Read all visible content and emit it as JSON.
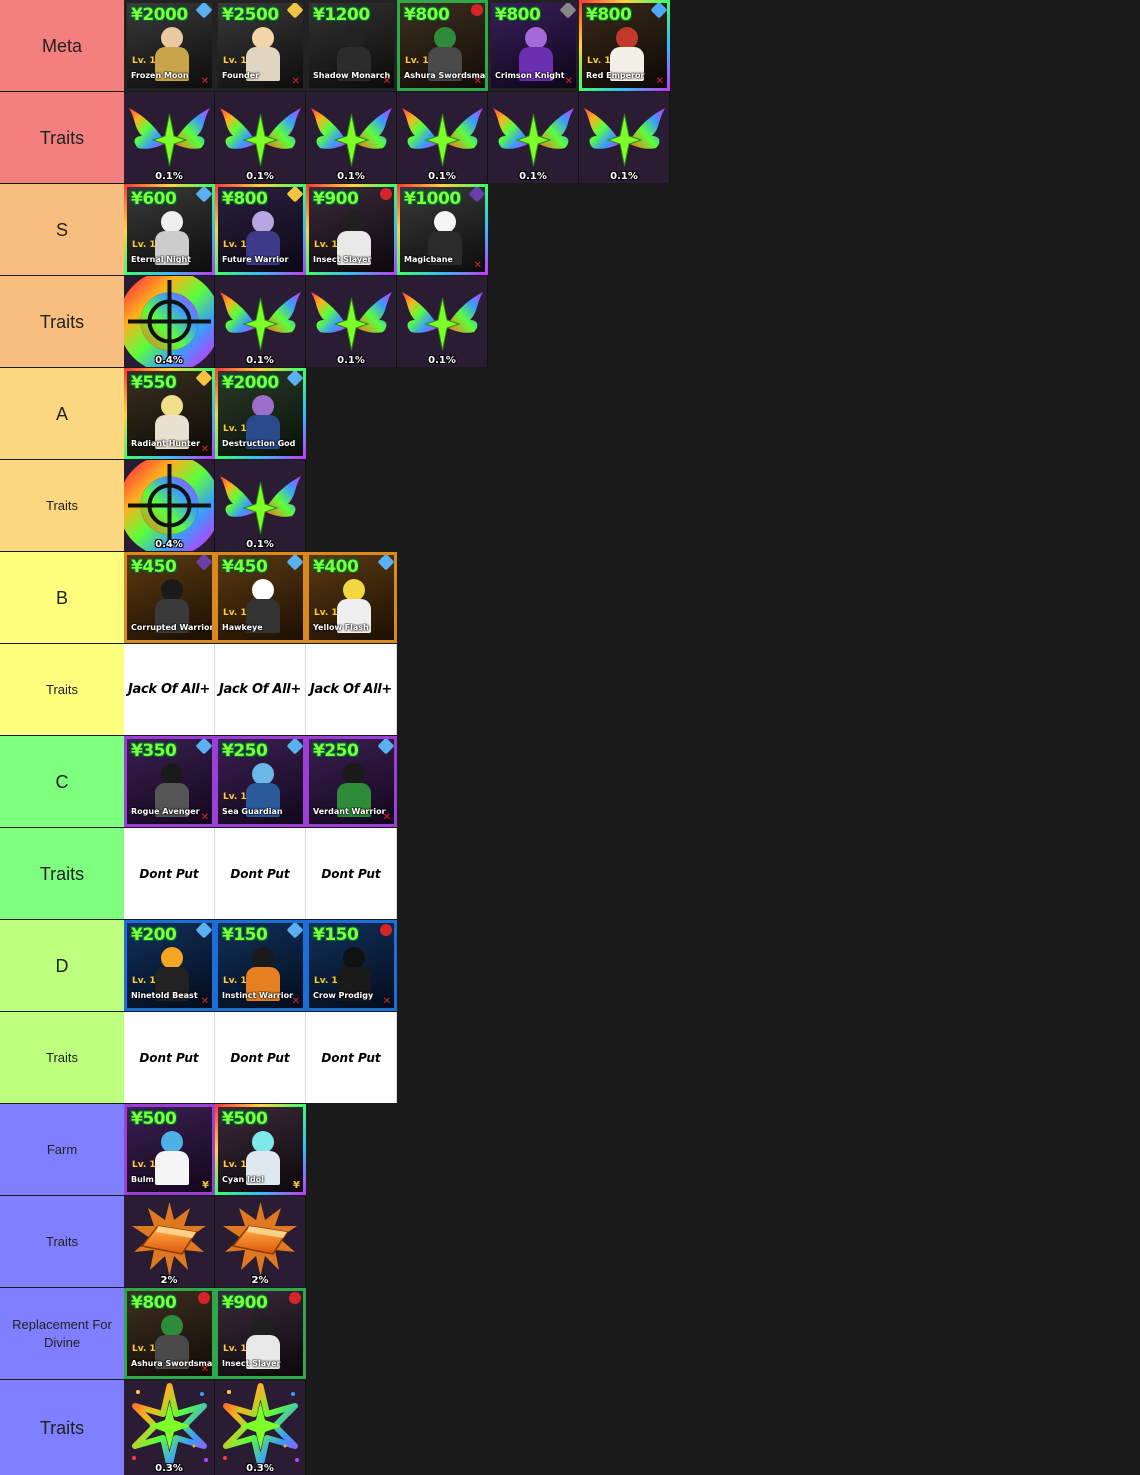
{
  "colors": {
    "red": "#f47f7f",
    "orange": "#f7be7f",
    "lightorange": "#fbd77f",
    "yellow": "#ffff7f",
    "green": "#7fff7f",
    "lime": "#bfff7f",
    "purple": "#7f7fff"
  },
  "tiers": [
    {
      "label": "Meta",
      "color": "#f47f7f",
      "units": [
        {
          "cost": "¥2000",
          "lvl": "Lv. 1",
          "name": "Frozen Moon"
        },
        {
          "cost": "¥2500",
          "lvl": "Lv. 1",
          "name": "Founder"
        },
        {
          "cost": "¥1200",
          "lvl": "",
          "name": "Shadow Monarch"
        },
        {
          "cost": "¥800",
          "lvl": "Lv. 1",
          "name": "Ashura Swordsman"
        },
        {
          "cost": "¥800",
          "lvl": "",
          "name": "Crimson Knight"
        },
        {
          "cost": "¥800",
          "lvl": "Lv. 1",
          "name": "Red Emperor"
        }
      ]
    },
    {
      "label": "Traits",
      "color": "#f47f7f",
      "traits": [
        "0.1%",
        "0.1%",
        "0.1%",
        "0.1%",
        "0.1%",
        "0.1%"
      ]
    },
    {
      "label": "S",
      "color": "#f7be7f",
      "units": [
        {
          "cost": "¥600",
          "lvl": "Lv. 1",
          "name": "Eternal Night"
        },
        {
          "cost": "¥800",
          "lvl": "Lv. 1",
          "name": "Future Warrior"
        },
        {
          "cost": "¥900",
          "lvl": "Lv. 1",
          "name": "Insect Slayer"
        },
        {
          "cost": "¥1000",
          "lvl": "",
          "name": "Magicbane"
        }
      ]
    },
    {
      "label": "Traits",
      "color": "#f7be7f",
      "traits": [
        "0.4%",
        "0.1%",
        "0.1%",
        "0.1%"
      ]
    },
    {
      "label": "A",
      "color": "#fbd77f",
      "units": [
        {
          "cost": "¥550",
          "lvl": "",
          "name": "Radiant Hunter"
        },
        {
          "cost": "¥2000",
          "lvl": "Lv. 1",
          "name": "Destruction God"
        }
      ]
    },
    {
      "label": "Traits",
      "color": "#fbd77f",
      "traits": [
        "0.4%",
        "0.1%"
      ]
    },
    {
      "label": "B",
      "color": "#ffff7f",
      "units": [
        {
          "cost": "¥450",
          "lvl": "",
          "name": "Corrupted Warrior"
        },
        {
          "cost": "¥450",
          "lvl": "Lv. 1",
          "name": "Hawkeye"
        },
        {
          "cost": "¥400",
          "lvl": "Lv. 1",
          "name": "Yellow Flash"
        }
      ]
    },
    {
      "label": "Traits",
      "color": "#ffff7f",
      "text_items": [
        "Jack Of All+",
        "Jack Of All+",
        "Jack Of All+"
      ]
    },
    {
      "label": "C",
      "color": "#7fff7f",
      "units": [
        {
          "cost": "¥350",
          "lvl": "",
          "name": "Rogue Avenger"
        },
        {
          "cost": "¥250",
          "lvl": "Lv. 1",
          "name": "Sea Guardian"
        },
        {
          "cost": "¥250",
          "lvl": "",
          "name": "Verdant Warrior"
        }
      ]
    },
    {
      "label": "Traits",
      "color": "#7fff7f",
      "text_items": [
        "Dont Put",
        "Dont Put",
        "Dont Put"
      ]
    },
    {
      "label": "D",
      "color": "#bfff7f",
      "units": [
        {
          "cost": "¥200",
          "lvl": "Lv. 1",
          "name": "Ninetold Beast"
        },
        {
          "cost": "¥150",
          "lvl": "Lv. 1",
          "name": "Instinct Warrior"
        },
        {
          "cost": "¥150",
          "lvl": "Lv. 1",
          "name": "Crow Prodigy"
        }
      ]
    },
    {
      "label": "Traits",
      "color": "#bfff7f",
      "text_items": [
        "Dont Put",
        "Dont Put",
        "Dont Put"
      ]
    },
    {
      "label": "Farm",
      "color": "#7f7fff",
      "units": [
        {
          "cost": "¥500",
          "lvl": "Lv. 1",
          "name": "Bulm"
        },
        {
          "cost": "¥500",
          "lvl": "Lv. 1",
          "name": "Cyan Idol"
        }
      ]
    },
    {
      "label": "Traits",
      "color": "#7f7fff",
      "traits": [
        "2%",
        "2%"
      ]
    },
    {
      "label": "Replacement For Divine",
      "color": "#7f7fff",
      "units": [
        {
          "cost": "¥800",
          "lvl": "Lv. 1",
          "name": "Ashura Swordsman"
        },
        {
          "cost": "¥900",
          "lvl": "Lv. 1",
          "name": "Insect Slayer"
        }
      ]
    },
    {
      "label": "Traits",
      "color": "#7f7fff",
      "traits": [
        "0.3%",
        "0.3%"
      ]
    }
  ]
}
